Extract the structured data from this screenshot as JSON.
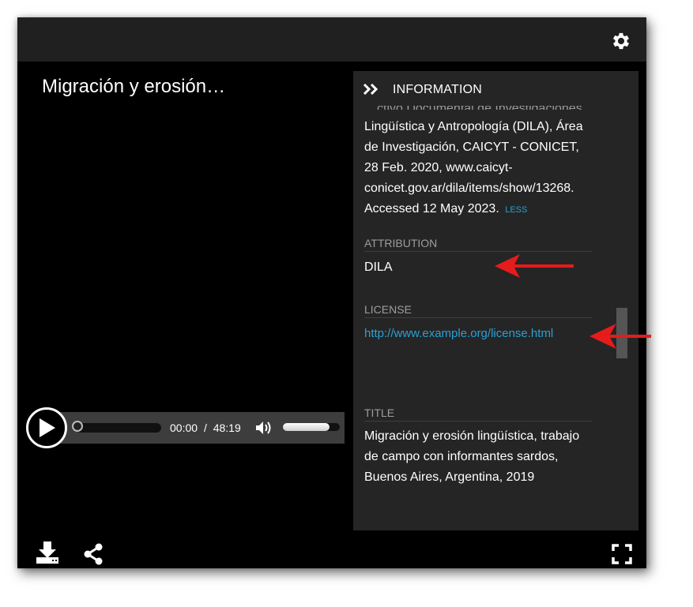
{
  "player": {
    "title": "Migración y erosión…",
    "time": {
      "current": "00:00",
      "separator": "/",
      "total": "48:19"
    },
    "volume_level": 0.82,
    "progress": 0
  },
  "info_panel": {
    "header": "INFORMATION",
    "citation_cut": "…ctivo Documental de Investigaciones de",
    "citation": "Lingüística y Antropología (DILA), Área de Investigación, CAICYT - CONICET, 28 Feb. 2020, www.caicyt-conicet.gov.ar/dila/items/show/13268. Accessed 12 May 2023.",
    "less_label": "LESS",
    "attribution_label": "ATTRIBUTION",
    "attribution_value": "DILA",
    "license_label": "LICENSE",
    "license_value": "http://www.example.org/license.html",
    "title_label": "TITLE",
    "title_value": "Migración y erosión lingüística, trabajo de campo con informantes sardos, Buenos Aires, Argentina, 2019"
  },
  "icons": [
    "gear-icon",
    "play-icon",
    "volume-icon",
    "chevron-double-right-icon",
    "download-icon",
    "share-icon",
    "fullscreen-icon"
  ],
  "colors": {
    "link": "#2aa0d4",
    "annotation_arrow": "#e61b1b",
    "panel_bg": "#252525",
    "topbar_bg": "#202020"
  }
}
